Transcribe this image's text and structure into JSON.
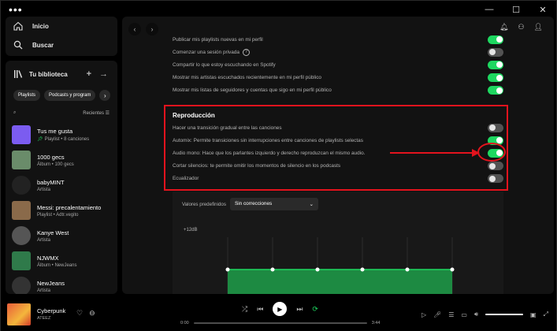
{
  "window": {
    "menu_dots": "•••",
    "minimize": "—",
    "maximize": "☐",
    "close": "✕"
  },
  "nav": {
    "home": "Inicio",
    "search": "Buscar"
  },
  "library": {
    "title": "Tu biblioteca",
    "add": "+",
    "expand": "→",
    "chips": [
      "Playlists",
      "Podcasts y program"
    ],
    "sort_label": "Recientes",
    "items": [
      {
        "title": "Tus me gusta",
        "subtitle": "Playlist • 8 canciones",
        "pinned": true,
        "cover": "#7b5cf0",
        "round": false
      },
      {
        "title": "1000 gecs",
        "subtitle": "Álbum • 100 gecs",
        "pinned": false,
        "cover": "#6a8c6a",
        "round": false
      },
      {
        "title": "babyMINT",
        "subtitle": "Artista",
        "pinned": false,
        "cover": "#222222",
        "round": true
      },
      {
        "title": "Messi: precalentamiento",
        "subtitle": "Playlist • Adtr.vegito",
        "pinned": false,
        "cover": "#8a6a4a",
        "round": false
      },
      {
        "title": "Kanye West",
        "subtitle": "Artista",
        "pinned": false,
        "cover": "#555555",
        "round": true
      },
      {
        "title": "NJWMX",
        "subtitle": "Álbum • NewJeans",
        "pinned": false,
        "cover": "#2f7a4a",
        "round": false
      },
      {
        "title": "NewJeans",
        "subtitle": "Artista",
        "pinned": false,
        "cover": "#333333",
        "round": true
      }
    ]
  },
  "settings": {
    "rows_top": [
      {
        "label": "Publicar mis playlists nuevas en mi perfil",
        "on": true
      },
      {
        "label": "Comenzar una sesión privada",
        "on": false,
        "info": "?"
      },
      {
        "label": "Compartir lo que estoy escuchando en Spotify",
        "on": true
      },
      {
        "label": "Mostrar mis artistas escuchados recientemente en mi perfil público",
        "on": true
      },
      {
        "label": "Mostrar mis listas de seguidores y cuentas que sigo en mi perfil público",
        "on": true
      }
    ],
    "section_title": "Reproducción",
    "rows_playback": [
      {
        "label": "Hacer una transición gradual entre las canciones",
        "on": false
      },
      {
        "label": "Automix: Permite transiciones sin interrupciones entre canciones de playlists selectas",
        "on": true
      },
      {
        "label": "Audio mono: Hace que los parlantes izquierdo y derecho reproduzcan el mismo audio.",
        "on": true
      },
      {
        "label": "Cortar silencios: te permite omitir los momentos de silencio en los podcasts",
        "on": false
      },
      {
        "label": "Ecualizador",
        "on": false
      }
    ]
  },
  "equalizer": {
    "presets_label": "Valores predefinidos",
    "preset_value": "Sin correcciones",
    "max_label": "+12dB"
  },
  "player": {
    "title": "Cyberpunk",
    "artist": "ATEEZ",
    "elapsed": "0:00",
    "duration": "3:44",
    "progress_fraction": 0.0,
    "volume_fraction": 1.0
  },
  "colors": {
    "accent": "#1ed760",
    "annotation": "#e3131d",
    "panel": "#121212"
  }
}
